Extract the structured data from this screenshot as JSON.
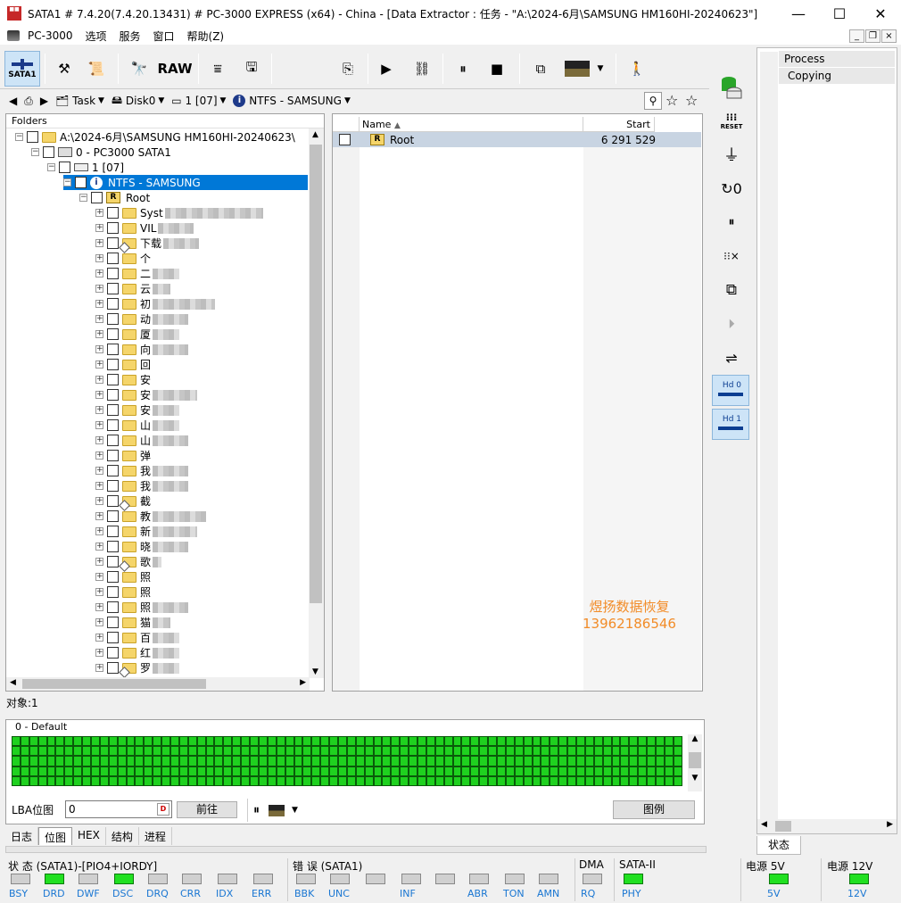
{
  "window": {
    "title": "SATA1 # 7.4.20(7.4.20.13431) # PC-3000 EXPRESS (x64) - China - [Data Extractor : 任务 - \"A:\\2024-6月\\SAMSUNG HM160HI-20240623\"]"
  },
  "menu": {
    "items": [
      "PC-3000",
      "选项",
      "服务",
      "窗口",
      "帮助(Z)"
    ]
  },
  "toolbar": {
    "sata1_label": "SATA1",
    "raw_label": "RAW"
  },
  "navbar": {
    "task": "Task",
    "disk": "Disk0",
    "partition": "1 [07]",
    "fs": "NTFS - SAMSUNG"
  },
  "folders": {
    "header": "Folders",
    "root_path": "A:\\2024-6月\\SAMSUNG HM160HI-20240623\\",
    "device": "0 - PC3000 SATA1",
    "partition": "1 [07]",
    "volume": "NTFS - SAMSUNG",
    "root": "Root",
    "items": [
      "Syst",
      "VIL",
      "下载",
      "个",
      "二",
      "云",
      "初",
      "动",
      "厦",
      "向",
      "回",
      "安",
      "安",
      "安",
      "山",
      "山",
      "弹",
      "我",
      "我",
      "截",
      "教",
      "新",
      "晓",
      "歌",
      "照",
      "照",
      "照",
      "猫",
      "百",
      "红",
      "罗"
    ]
  },
  "files": {
    "col_name": "Name",
    "col_start": "Start",
    "rows": [
      {
        "name": "Root",
        "start": "6 291 529"
      }
    ]
  },
  "watermark": {
    "line1": "煜扬数据恢复",
    "line2": "13962186546"
  },
  "status": {
    "objects": "对象:1"
  },
  "bitmap": {
    "title": "0 - Default",
    "lba_label": "LBA位图",
    "lba_value": "0",
    "goto_label": "前往",
    "legend_label": "图例"
  },
  "tabs": [
    "日志",
    "位图",
    "HEX",
    "结构",
    "进程"
  ],
  "process": {
    "col_header": "Process",
    "row": "Copying",
    "bottom_tab": "状态"
  },
  "right_tools": {
    "reset_label": "RESET",
    "hd0": "Hd 0",
    "hd1": "Hd 1"
  },
  "status_bar": {
    "state_title": "状 态 (SATA1)-[PIO4+IORDY]",
    "error_title": "错 误 (SATA1)",
    "dma_title": "DMA",
    "sata_title": "SATA-II",
    "power5_title": "电源 5V",
    "power12_title": "电源 12V",
    "state_leds": [
      "BSY",
      "DRD",
      "DWF",
      "DSC",
      "DRQ",
      "CRR",
      "IDX",
      "ERR"
    ],
    "error_leds": [
      "BBK",
      "UNC",
      "",
      "INF",
      "",
      "ABR",
      "TON",
      "AMN"
    ],
    "dma_led": "RQ",
    "sata_led": "PHY",
    "power5_led": "5V",
    "power12_led": "12V"
  },
  "colors": {
    "selection": "#0078d7",
    "led_on": "#21e021",
    "watermark": "#f28c28"
  }
}
